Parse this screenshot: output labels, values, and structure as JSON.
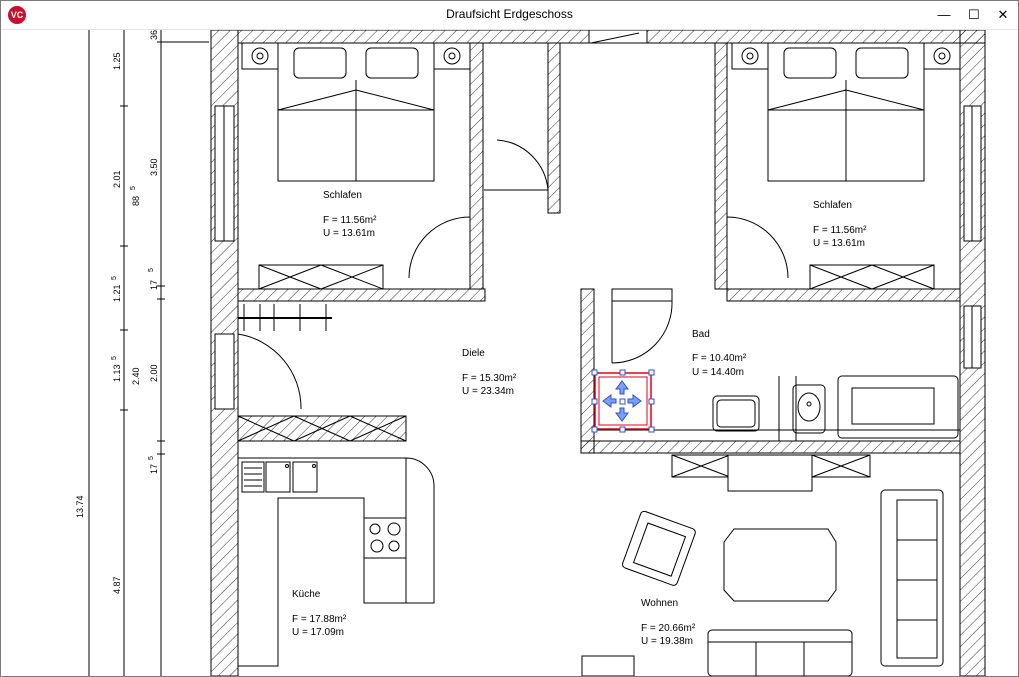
{
  "window": {
    "title": "Draufsicht Erdgeschoss",
    "app_icon_text": "VC",
    "app_icon_color": "#c8102e",
    "minimize_symbol": "—",
    "maximize_symbol": "☐",
    "close_symbol": "✕"
  },
  "dimensions": {
    "col1": [
      "1.25",
      "2.01",
      "1.21",
      "1.13",
      "4.87"
    ],
    "col1_sup": [
      "",
      "",
      "5",
      "5",
      ""
    ],
    "col2": [
      "3.50",
      "88",
      "17",
      "2.40",
      "2.00",
      "17"
    ],
    "col2_sup": [
      "",
      "5",
      "5",
      "",
      "",
      "5"
    ],
    "col0": [
      "13.74"
    ],
    "top_clip": "36"
  },
  "rooms": [
    {
      "name": "Schlafen",
      "area": "F = 11.56m²",
      "perimeter": "U = 13.61m"
    },
    {
      "name": "Schlafen",
      "area": "F = 11.56m²",
      "perimeter": "U = 13.61m"
    },
    {
      "name": "Diele",
      "area": "F = 15.30m²",
      "perimeter": "U = 23.34m"
    },
    {
      "name": "Bad",
      "area": "F = 10.40m²",
      "perimeter": "U = 14.40m"
    },
    {
      "name": "Küche",
      "area": "F = 17.88m²",
      "perimeter": "U = 17.09m"
    },
    {
      "name": "Wohnen",
      "area": "F = 20.66m²",
      "perimeter": "U = 19.38m"
    }
  ],
  "colors": {
    "selection": "#e0001a",
    "handle": "#3050c8",
    "arrow_fill": "#7aa0ff"
  },
  "icons": [
    "app-logo-icon",
    "minimize-icon",
    "maximize-icon",
    "close-icon",
    "move-arrows-icon"
  ]
}
